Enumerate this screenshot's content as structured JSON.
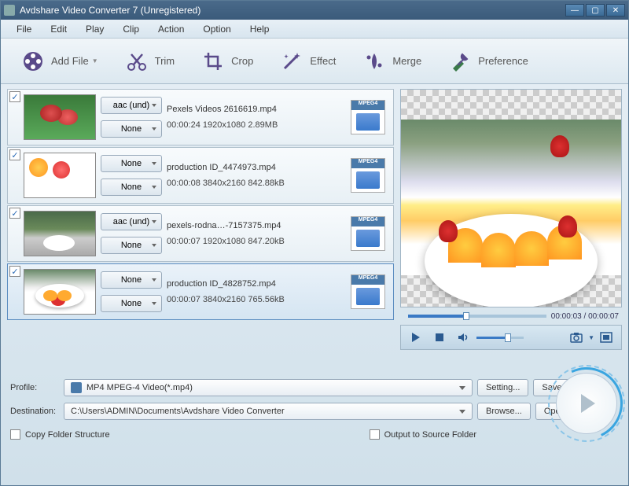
{
  "titlebar": {
    "title": "Avdshare Video Converter 7 (Unregistered)"
  },
  "menubar": [
    "File",
    "Edit",
    "Play",
    "Clip",
    "Action",
    "Option",
    "Help"
  ],
  "toolbar": {
    "addfile": "Add File",
    "trim": "Trim",
    "crop": "Crop",
    "effect": "Effect",
    "merge": "Merge",
    "preference": "Preference"
  },
  "files": [
    {
      "checked": true,
      "codec1": "aac (und)",
      "codec2": "None",
      "name": "Pexels Videos 2616619.mp4",
      "meta": "00:00:24  1920x1080 2.89MB",
      "format": "MPEG4"
    },
    {
      "checked": true,
      "codec1": "None",
      "codec2": "None",
      "name": "production ID_4474973.mp4",
      "meta": "00:00:08  3840x2160 842.88kB",
      "format": "MPEG4"
    },
    {
      "checked": true,
      "codec1": "aac (und)",
      "codec2": "None",
      "name": "pexels-rodna…-7157375.mp4",
      "meta": "00:00:07  1920x1080 847.20kB",
      "format": "MPEG4"
    },
    {
      "checked": true,
      "codec1": "None",
      "codec2": "None",
      "name": "production ID_4828752.mp4",
      "meta": "00:00:07  3840x2160 765.56kB",
      "format": "MPEG4"
    }
  ],
  "preview": {
    "current": "00:00:03",
    "total": "00:00:07"
  },
  "profile": {
    "label": "Profile:",
    "value": "MP4 MPEG-4 Video(*.mp4)",
    "setting": "Setting...",
    "saveas": "Save As..."
  },
  "destination": {
    "label": "Destination:",
    "value": "C:\\Users\\ADMIN\\Documents\\Avdshare Video Converter",
    "browse": "Browse...",
    "open": "Open Folder"
  },
  "options": {
    "copyfolder": "Copy Folder Structure",
    "outputsrc": "Output to Source Folder"
  }
}
